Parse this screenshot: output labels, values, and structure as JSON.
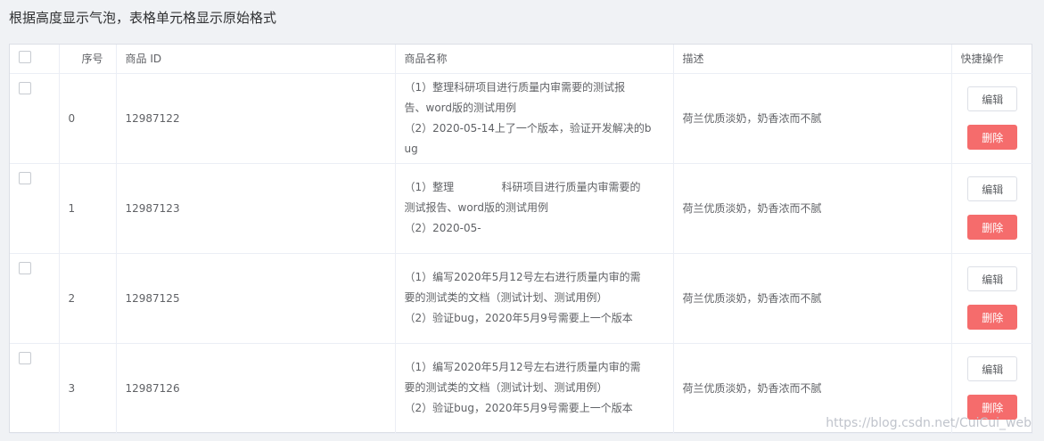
{
  "page": {
    "title": "根据高度显示气泡，表格单元格显示原始格式"
  },
  "table": {
    "headers": {
      "index": "序号",
      "id": "商品 ID",
      "name": "商品名称",
      "desc": "描述",
      "ops": "快捷操作"
    },
    "edit_label": "编辑",
    "delete_label": "删除",
    "rows": [
      {
        "index": "0",
        "id": "12987122",
        "name_lines": [
          "（1）整理科研项目进行质量内审需要的测试报",
          "告、word版的测试用例",
          "（2）2020-05-14上了一个版本，验证开发解决的b",
          "ug"
        ],
        "desc": "荷兰优质淡奶，奶香浓而不腻"
      },
      {
        "index": "1",
        "id": "12987123",
        "name_lines": [
          "（1）整理              科研项目进行质量内审需要的",
          "测试报告、word版的测试用例",
          "（2）2020-05-"
        ],
        "desc": "荷兰优质淡奶，奶香浓而不腻"
      },
      {
        "index": "2",
        "id": "12987125",
        "name_lines": [
          "（1）编写2020年5月12号左右进行质量内审的需",
          "要的测试类的文档（测试计划、测试用例）",
          "（2）验证bug，2020年5月9号需要上一个版本"
        ],
        "desc": "荷兰优质淡奶，奶香浓而不腻"
      },
      {
        "index": "3",
        "id": "12987126",
        "name_lines": [
          "（1）编写2020年5月12号左右进行质量内审的需",
          "要的测试类的文档（测试计划、测试用例）",
          "（2）验证bug，2020年5月9号需要上一个版本"
        ],
        "desc": "荷兰优质淡奶，奶香浓而不腻"
      }
    ]
  },
  "watermark": "https://blog.csdn.net/CuiCui_web"
}
